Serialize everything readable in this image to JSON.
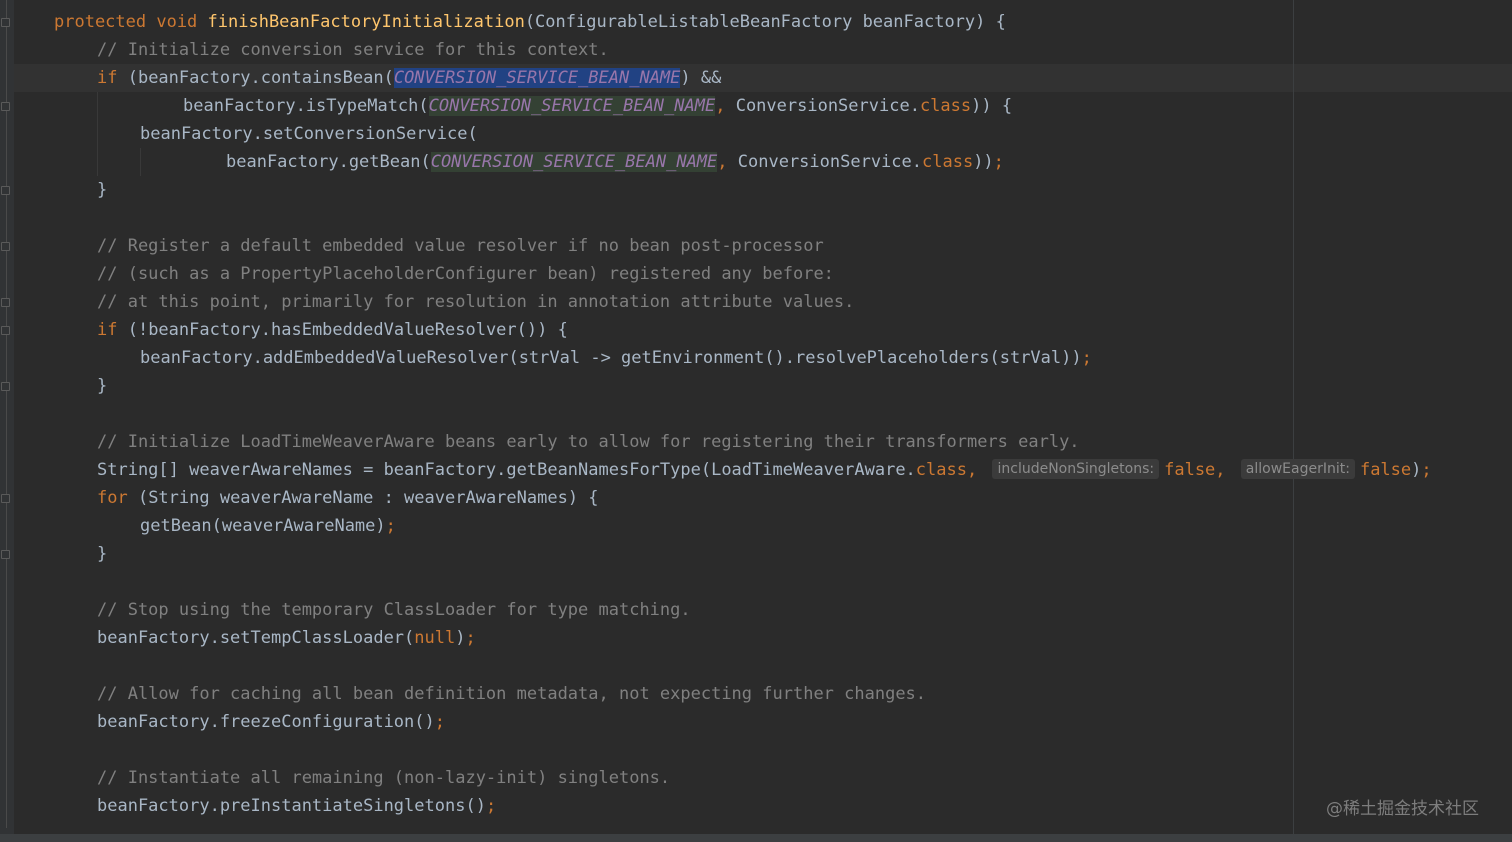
{
  "editor": {
    "method_signature": {
      "modifiers": "protected void ",
      "name": "finishBeanFactoryInitialization",
      "params": "(ConfigurableListableBeanFactory beanFactory) {"
    },
    "constant": "CONVERSION_SERVICE_BEAN_NAME",
    "comments": {
      "c1": "// Initialize conversion service for this context.",
      "c2": "// Register a default embedded value resolver if no bean post-processor",
      "c3": "// (such as a PropertyPlaceholderConfigurer bean) registered any before:",
      "c4": "// at this point, primarily for resolution in annotation attribute values.",
      "c5": "// Initialize LoadTimeWeaverAware beans early to allow for registering their transformers early.",
      "c6": "// Stop using the temporary ClassLoader for type matching.",
      "c7": "// Allow for caching all bean definition metadata, not expecting further changes.",
      "c8": "// Instantiate all remaining (non-lazy-init) singletons."
    },
    "tokens": {
      "if": "if",
      "for": "for",
      "class": "class",
      "null": "null",
      "false": "false",
      "semicolon": ";",
      "comma": ",",
      "close_brace": "}"
    },
    "code": {
      "l3_pre": " (beanFactory.containsBean(",
      "l3_post": ") &&",
      "l4_pre": "beanFactory.isTypeMatch(",
      "l4_mid": " ConversionService.",
      "l4_post": ")) {",
      "l5": "beanFactory.setConversionService(",
      "l6_pre": "beanFactory.getBean(",
      "l6_mid": " ConversionService.",
      "l6_post": "))",
      "l12": " (!beanFactory.hasEmbeddedValueResolver()) {",
      "l13": "beanFactory.addEmbeddedValueResolver(strVal -> getEnvironment().resolvePlaceholders(strVal))",
      "l17_pre": "String[] weaverAwareNames = beanFactory.getBeanNamesForType(LoadTimeWeaverAware.",
      "l17_post": ")",
      "l18": " (String weaverAwareName : weaverAwareNames) {",
      "l19": "getBean(weaverAwareName)",
      "l23_pre": "beanFactory.setTempClassLoader(",
      "l23_post": ")",
      "l26": "beanFactory.freezeConfiguration()",
      "l29": "beanFactory.preInstantiateSingletons()"
    },
    "hints": {
      "include_non_singletons": "includeNonSingletons:",
      "allow_eager_init": "allowEagerInit:"
    }
  },
  "watermark": "@稀土掘金技术社区"
}
